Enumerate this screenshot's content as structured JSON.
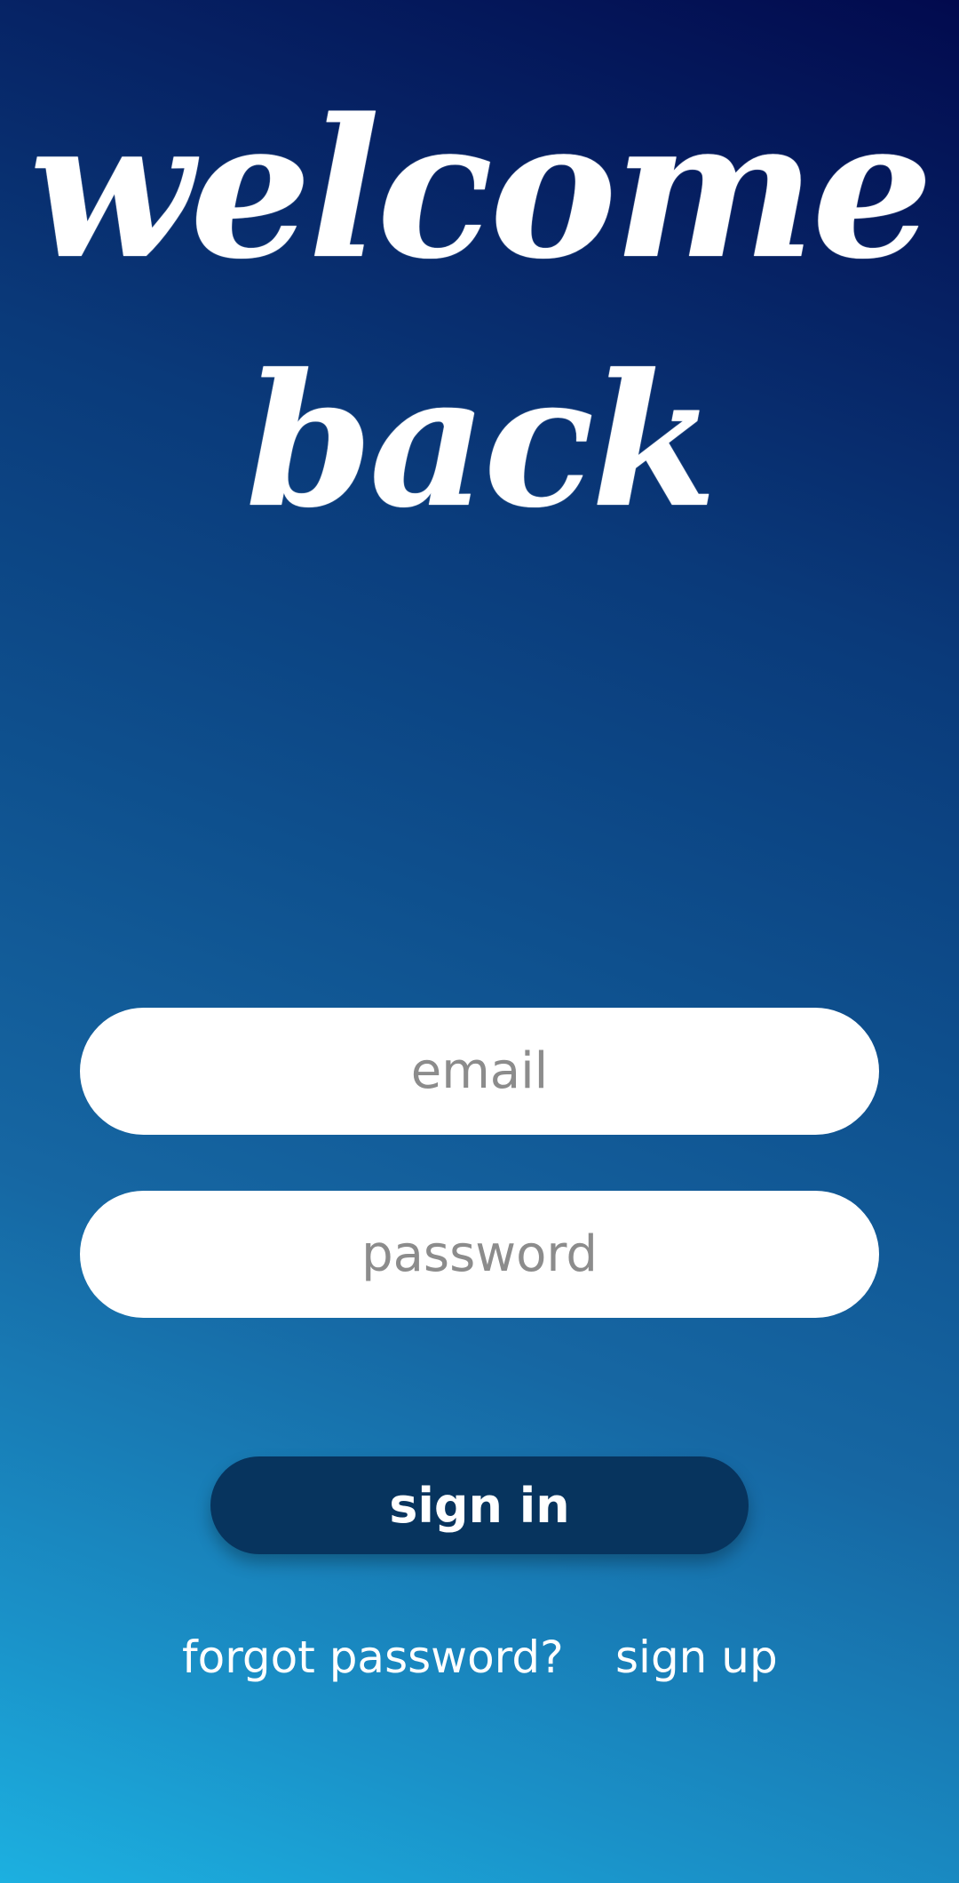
{
  "header": {
    "title_line_1": "welcome",
    "title_line_2": "back"
  },
  "form": {
    "email": {
      "placeholder": "email",
      "value": ""
    },
    "password": {
      "placeholder": "password",
      "value": ""
    },
    "signin_label": "sign in"
  },
  "links": {
    "forgot_password": "forgot password?",
    "sign_up": "sign up"
  },
  "colors": {
    "background_top": "#020a4e",
    "background_bottom": "#1cb0e0",
    "button": "#07345e",
    "field": "#ffffff",
    "placeholder": "#8c8c8c",
    "text": "#ffffff"
  }
}
